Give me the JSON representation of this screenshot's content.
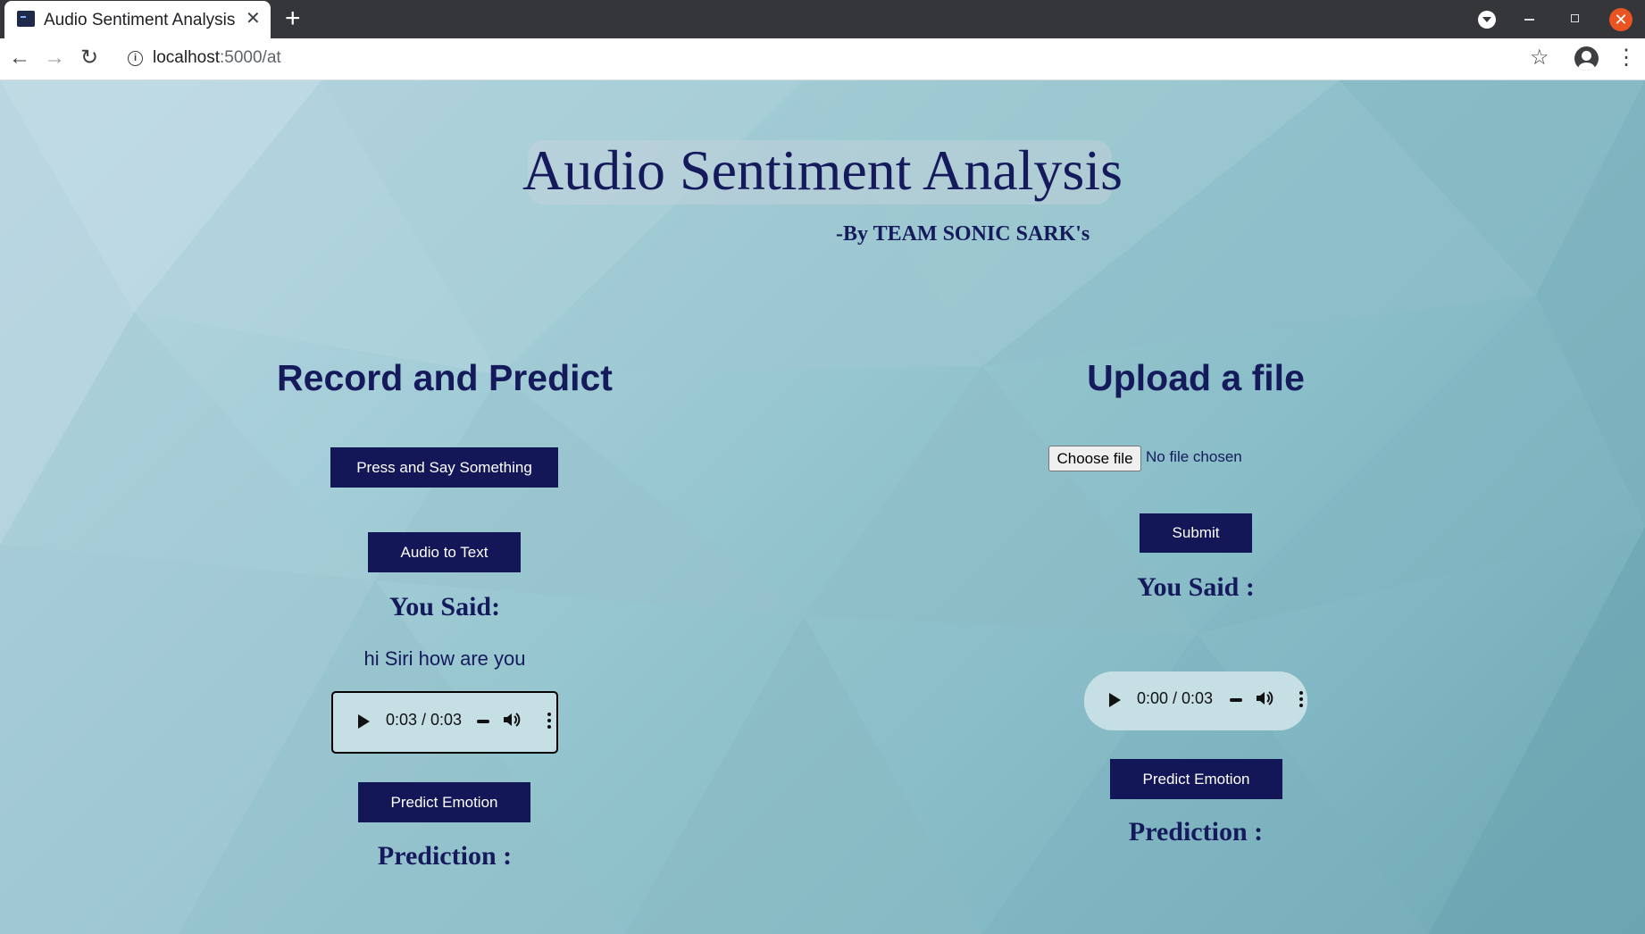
{
  "browser": {
    "tab_title": "Audio Sentiment Analysis",
    "tab_close": "✕",
    "new_tab": "+",
    "url_host": "localhost",
    "url_path": ":5000/at",
    "icons": [
      "back-icon",
      "forward-icon",
      "reload-icon",
      "info-icon",
      "star-icon",
      "account-icon",
      "menu-icon",
      "minimize-icon",
      "maximize-icon",
      "close-icon"
    ]
  },
  "page": {
    "title": "Audio Sentiment Analysis",
    "byline": "-By TEAM SONIC SARK's",
    "colors": {
      "accent": "#131758",
      "text": "#151a5c",
      "close": "#e95420"
    }
  },
  "record": {
    "heading": "Record and Predict",
    "record_button": "Press and Say Something",
    "audio_to_text_button": "Audio to Text",
    "you_said_label": "You Said:",
    "you_said_text": "hi Siri how are you",
    "audio_time": "0:03 / 0:03",
    "predict_button": "Predict Emotion",
    "prediction_label": "Prediction :"
  },
  "upload": {
    "heading": "Upload a file",
    "choose_file_button": "Choose file",
    "file_status": "No file chosen",
    "submit_button": "Submit",
    "you_said_label": "You Said :",
    "audio_time": "0:00 / 0:03",
    "predict_button": "Predict Emotion",
    "prediction_label": "Prediction :"
  }
}
